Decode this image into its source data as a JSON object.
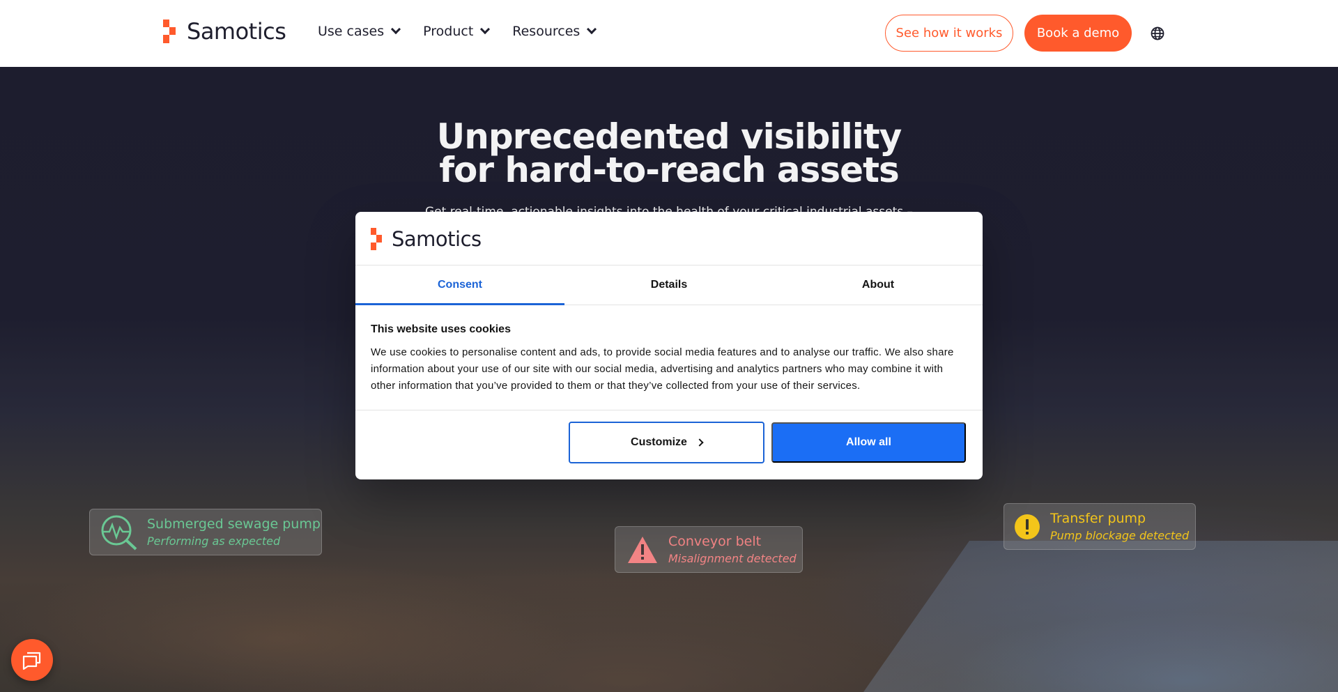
{
  "brand": {
    "name": "Samotics",
    "accent": "#ff5a2c",
    "primary_blue": "#1b6ef5"
  },
  "nav": {
    "items": [
      {
        "label": "Use cases"
      },
      {
        "label": "Product"
      },
      {
        "label": "Resources"
      }
    ],
    "cta_secondary": "See how it works",
    "cta_primary": "Book a demo",
    "language_icon": "globe-icon"
  },
  "hero": {
    "title_line1": "Unprecedented visibility",
    "title_line2": "for hard-to-reach assets",
    "subtitle": "Get real-time, actionable insights into the health of your critical industrial assets –"
  },
  "status_cards": [
    {
      "title": "Submerged sewage pump",
      "status": "Performing as expected",
      "icon": "monitoring-icon",
      "color": "#6fd29a"
    },
    {
      "title": "Conveyor belt",
      "status": "Misalignment detected",
      "icon": "warning-icon",
      "color": "#ff8b8b"
    },
    {
      "title": "Transfer pump",
      "status": "Pump blockage detected",
      "icon": "alert-icon",
      "color": "#ffcf1a"
    }
  ],
  "consent": {
    "tabs": [
      {
        "label": "Consent",
        "active": true
      },
      {
        "label": "Details",
        "active": false
      },
      {
        "label": "About",
        "active": false
      }
    ],
    "heading": "This website uses cookies",
    "body": "We use cookies to personalise content and ads, to provide social media features and to analyse our traffic. We also share information about your use of our site with our social media, advertising and analytics partners who may combine it with other information that you’ve provided to them or that they’ve collected from your use of their services.",
    "customize_label": "Customize",
    "allow_label": "Allow all"
  },
  "chat": {
    "icon": "chat-icon"
  }
}
